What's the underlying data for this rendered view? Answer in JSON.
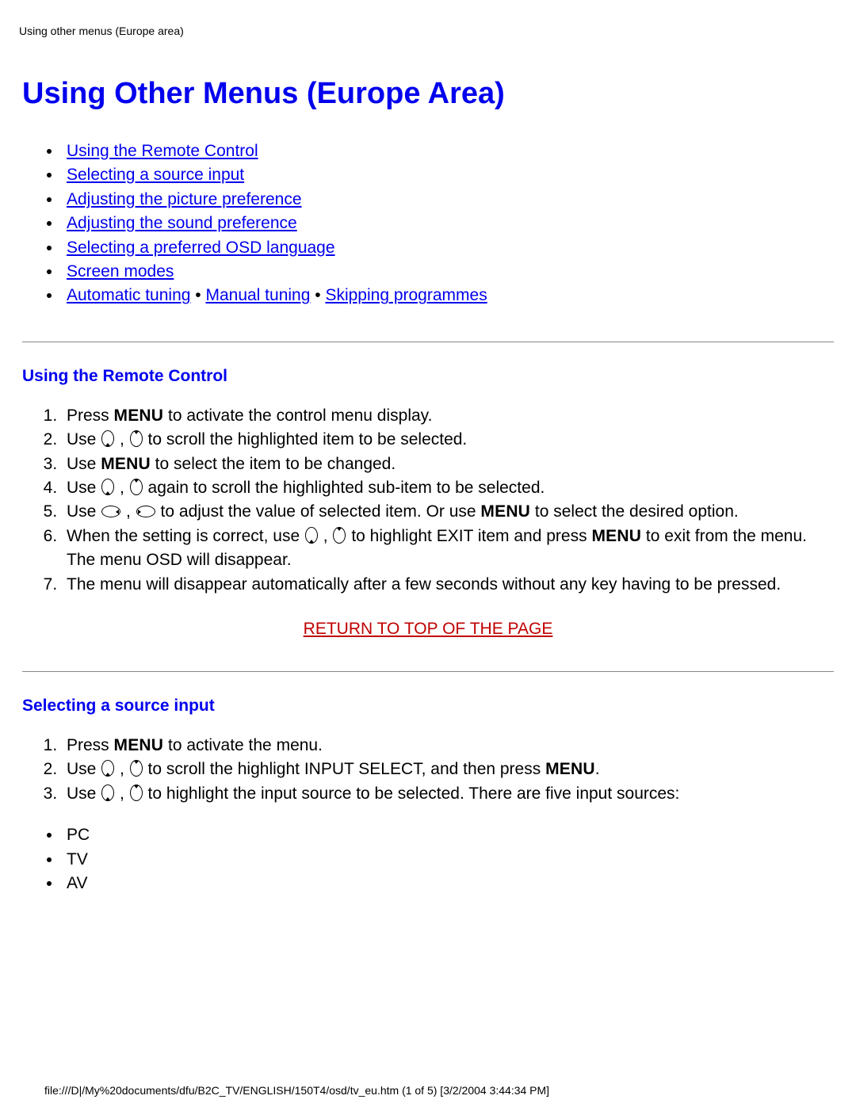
{
  "header_path": "Using other menus (Europe area)",
  "title": "Using Other Menus (Europe Area)",
  "nav": {
    "remote": "Using the Remote Control",
    "source": "Selecting a source input",
    "picture": "Adjusting the picture preference",
    "sound": "Adjusting the sound preference",
    "osd": "Selecting a preferred OSD language",
    "screen": "Screen modes",
    "auto": "Automatic tuning",
    "sep": " • ",
    "manual": "Manual tuning",
    "skip": "Skipping programmes"
  },
  "menu_label": "MENU",
  "sec1": {
    "heading": "Using the Remote Control",
    "s1a": "Press ",
    "s1b": " to activate the control menu display.",
    "s2a": "Use ",
    "s2b": " , ",
    "s2c": " to scroll the highlighted item to be selected.",
    "s3a": "Use ",
    "s3b": " to select the item to be changed.",
    "s4a": "Use ",
    "s4b": " , ",
    "s4c": " again to scroll the highlighted sub-item to be selected.",
    "s5a": "Use ",
    "s5b": " , ",
    "s5c": " to adjust the value of selected item. Or use ",
    "s5d": " to select the desired option.",
    "s6a": "When the setting is correct, use ",
    "s6b": " , ",
    "s6c": " to highlight EXIT item and press ",
    "s6d": " to exit from the menu. The menu OSD will disappear.",
    "s7": "The menu will disappear automatically after a few seconds without any key having to be pressed."
  },
  "return_top": "RETURN TO TOP OF THE PAGE",
  "sec2": {
    "heading": "Selecting a source input",
    "s1a": "Press ",
    "s1b": " to activate the menu.",
    "s2a": "Use ",
    "s2b": " , ",
    "s2c": " to scroll the highlight INPUT SELECT, and then press ",
    "s2d": ".",
    "s3a": "Use ",
    "s3b": " , ",
    "s3c": " to highlight the input source to be selected. There are five input sources:",
    "sources": {
      "pc": "PC",
      "tv": "TV",
      "av": "AV"
    }
  },
  "footer_path": "file:///D|/My%20documents/dfu/B2C_TV/ENGLISH/150T4/osd/tv_eu.htm (1 of 5) [3/2/2004 3:44:34 PM]"
}
